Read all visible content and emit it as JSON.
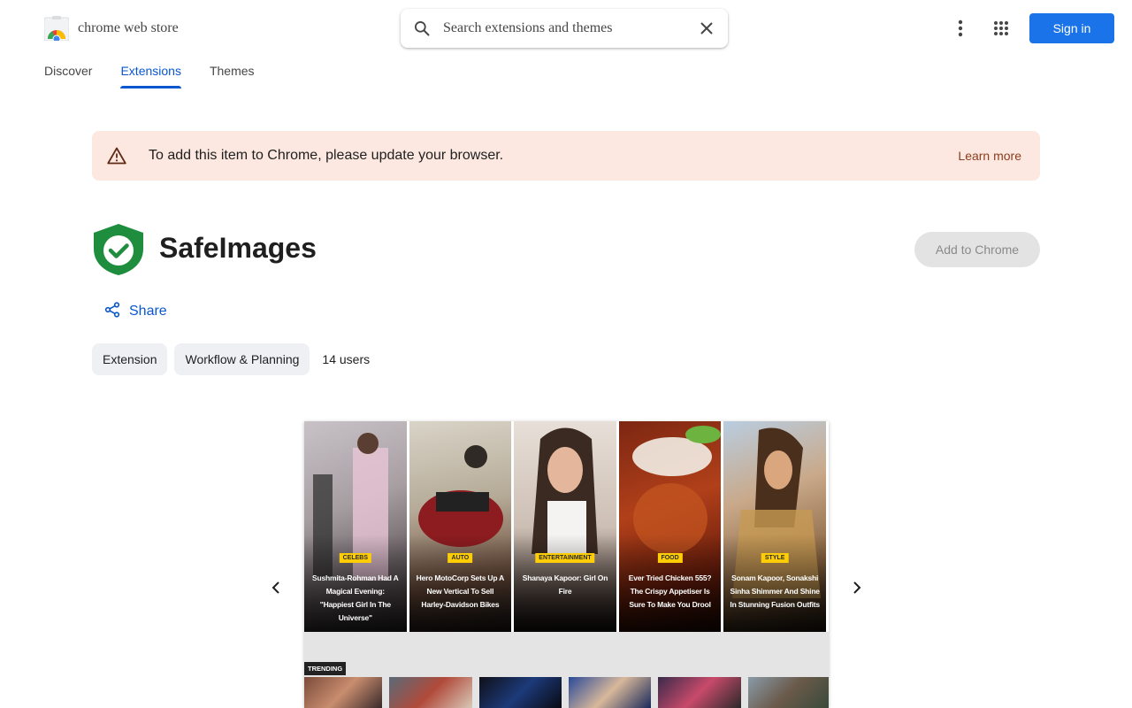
{
  "header": {
    "brand": "chrome web store",
    "search_placeholder": "Search extensions and themes",
    "sign_in": "Sign in"
  },
  "nav": {
    "tabs": [
      {
        "label": "Discover",
        "active": false
      },
      {
        "label": "Extensions",
        "active": true
      },
      {
        "label": "Themes",
        "active": false
      }
    ]
  },
  "banner": {
    "message": "To add this item to Chrome, please update your browser.",
    "link": "Learn more"
  },
  "extension": {
    "title": "SafeImages",
    "add_button": "Add to Chrome",
    "share": "Share",
    "chips": [
      "Extension",
      "Workflow & Planning"
    ],
    "users": "14 users"
  },
  "screenshot": {
    "cards": [
      {
        "category": "CELEBS",
        "caption": "Sushmita-Rohman Had A Magical Evening: \"Happiest Girl In The Universe\""
      },
      {
        "category": "AUTO",
        "caption": "Hero MotoCorp Sets Up A New Vertical To Sell Harley-Davidson Bikes"
      },
      {
        "category": "ENTERTAINMENT",
        "caption": "Shanaya Kapoor: Girl On Fire"
      },
      {
        "category": "FOOD",
        "caption": "Ever Tried Chicken 555? The Crispy Appetiser Is Sure To Make You Drool"
      },
      {
        "category": "STYLE",
        "caption": "Sonam Kapoor, Sonakshi Sinha Shimmer And Shine In Stunning Fusion Outfits"
      }
    ],
    "trending_label": "TRENDING"
  },
  "colors": {
    "accent": "#0b57d0",
    "signin_bg": "#1a73e8",
    "banner_bg": "#fce8e0",
    "shield_green": "#1e8e3e"
  }
}
